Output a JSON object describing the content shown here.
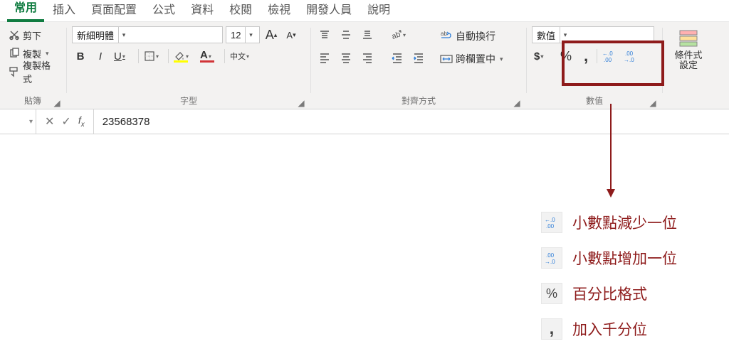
{
  "tabs": {
    "home": "常用",
    "insert": "插入",
    "layout": "頁面配置",
    "formulas": "公式",
    "data": "資料",
    "review": "校閱",
    "view": "檢視",
    "dev": "開發人員",
    "help": "說明"
  },
  "clipboard": {
    "cut": "剪下",
    "copy": "複製",
    "format_painter": "複製格式",
    "group_label": "貼簿"
  },
  "font": {
    "font_name": "新細明體",
    "font_size": "12",
    "increase_glyph": "A",
    "decrease_glyph": "A",
    "bold": "B",
    "italic": "I",
    "underline": "U",
    "phonetic": "中文",
    "group_label": "字型"
  },
  "alignment": {
    "wrap_text": "自動換行",
    "merge_center": "跨欄置中",
    "group_label": "對齊方式"
  },
  "number": {
    "format_name": "數值",
    "group_label": "數值"
  },
  "cond_format": {
    "line1": "條件式",
    "line2": "設定"
  },
  "formula_bar": {
    "value": "23568378"
  },
  "callouts": {
    "decrease_decimal": "小數點減少一位",
    "increase_decimal": "小數點增加一位",
    "percent": "百分比格式",
    "comma": "加入千分位"
  },
  "callout_glyphs": {
    "percent": "%",
    "comma": ","
  },
  "colors": {
    "accent": "#107c41",
    "outline": "#8e1b1b",
    "text_outline": "#8e1b1b"
  }
}
